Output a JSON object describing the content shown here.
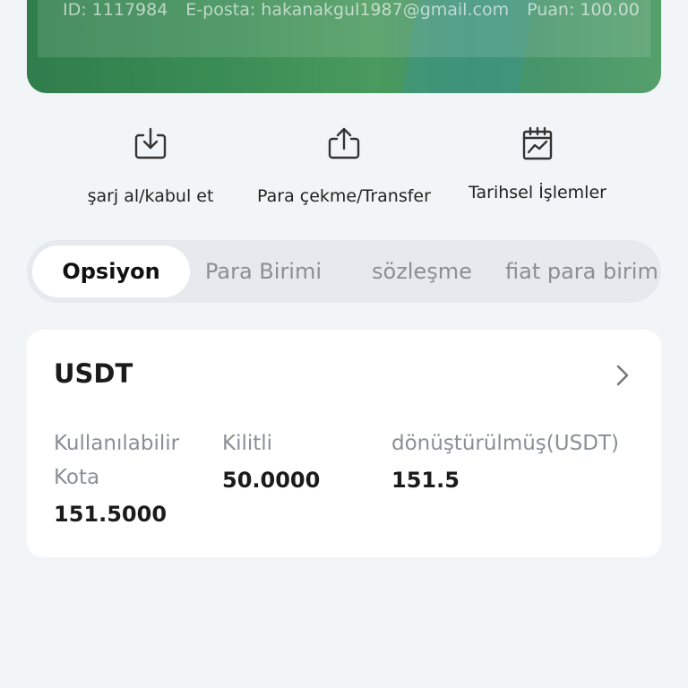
{
  "header": {
    "id_text": "ID: 1117984",
    "email_text": "E-posta: hakanakgul1987@gmail.com",
    "score_text": "Puan: 100.00",
    "colors": {
      "card_green": "#3a8c55"
    }
  },
  "actions": [
    {
      "label": "şarj al/kabul et",
      "icon": "download-icon"
    },
    {
      "label": "Para çekme/Transfer",
      "icon": "upload-icon"
    },
    {
      "label": "Tarihsel İşlemler",
      "icon": "calendar-chart-icon"
    }
  ],
  "tabs": [
    {
      "label": "Opsiyon",
      "active": true
    },
    {
      "label": "Para Birimi",
      "active": false
    },
    {
      "label": "sözleşme",
      "active": false
    },
    {
      "label": "fiat para birim",
      "active": false
    }
  ],
  "balance": {
    "coin": "USDT",
    "available_label": "Kullanılabilir Kota",
    "available_value": "151.5000",
    "locked_label": "Kilitli",
    "locked_value": "50.0000",
    "converted_label": "dönüştürülmüş(USDT)",
    "converted_value": "151.5"
  }
}
